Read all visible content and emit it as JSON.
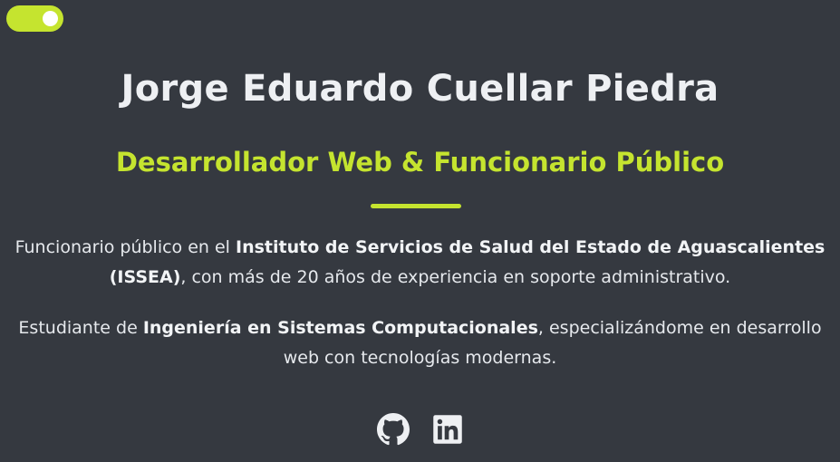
{
  "theme_toggle": {
    "state": "on",
    "color": "#c5e42f"
  },
  "hero": {
    "name": "Jorge Eduardo Cuellar Piedra",
    "role": "Desarrollador Web & Funcionario Público"
  },
  "about": {
    "p1": {
      "t1": "Funcionario público en el ",
      "b1": "Instituto de Servicios de Salud del Estado de Aguascalientes",
      "t2": " ",
      "b2": "(ISSEA)",
      "t3": ", con más de 20 años de experiencia en soporte administrativo."
    },
    "p2": {
      "t1": "Estudiante de ",
      "b1": "Ingeniería en Sistemas Computacionales",
      "t2": ", especializándome en desarrollo web con tecnologías modernas."
    }
  },
  "social": [
    {
      "icon": "github-icon"
    },
    {
      "icon": "linkedin-icon"
    }
  ],
  "colors": {
    "background": "#353940",
    "accent": "#c5e42f",
    "text": "#e8ebef"
  }
}
